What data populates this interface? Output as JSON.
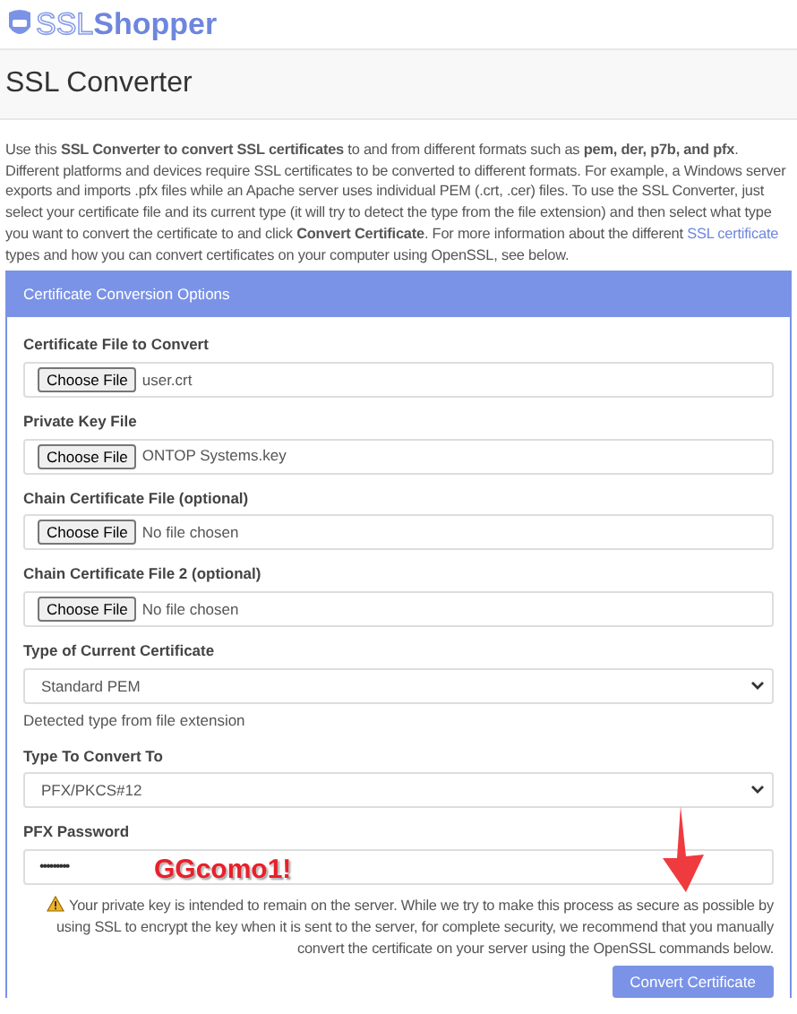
{
  "logo": {
    "text_light": "SSL",
    "text_bold": "Shopper"
  },
  "page_title": "SSL Converter",
  "intro": {
    "before_link": "Use this **SSL Converter to convert SSL certificates** to and from different formats such as **pem, der, p7b, and pfx**. Different platforms and devices require SSL certificates to be converted to different formats. For example, a Windows server exports and imports .pfx files while an Apache server uses individual PEM (.crt, .cer) files. To use the SSL Converter, just select your certificate file and its current type (it will try to detect the type from the file extension) and then select what type you want to convert the certificate to and click **Convert Certificate**. For more information about the different",
    "link": "SSL certificate",
    "after_link": "types and how you can convert certificates on your computer using OpenSSL, see below."
  },
  "panel": {
    "title": "Certificate Conversion Options",
    "fields": [
      {
        "kind": "file",
        "label": "Certificate File to Convert",
        "button": "Choose File",
        "value": "user.crt"
      },
      {
        "kind": "file",
        "label": "Private Key File",
        "button": "Choose File",
        "value": "ONTOP Systems.key"
      },
      {
        "kind": "file",
        "label": "Chain Certificate File (optional)",
        "button": "Choose File",
        "value": "No file chosen"
      },
      {
        "kind": "file",
        "label": "Chain Certificate File 2 (optional)",
        "button": "Choose File",
        "value": "No file chosen"
      },
      {
        "kind": "select",
        "label": "Type of Current Certificate",
        "value": "Standard PEM",
        "help": "Detected type from file extension"
      },
      {
        "kind": "select",
        "label": "Type To Convert To",
        "value": "PFX/PKCS#12"
      },
      {
        "kind": "password",
        "label": "PFX Password",
        "value": "•••••••••"
      }
    ],
    "warning": "Your private key is intended to remain on the server. While we try to make this process as secure as possible by using SSL to encrypt the key when it is sent to the server, for complete security, we recommend that you manually convert the certificate on your server using the OpenSSL commands below.",
    "submit": "Convert Certificate"
  },
  "annotations": [
    {
      "kind": "text",
      "text": "GGcomo1!"
    },
    {
      "kind": "arrow"
    }
  ]
}
